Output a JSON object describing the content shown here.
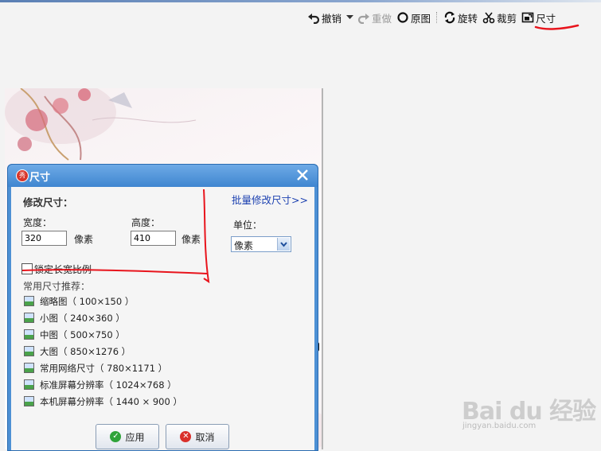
{
  "toolbar": {
    "undo": "撤销",
    "redo": "重做",
    "original": "原图",
    "rotate": "旋转",
    "crop": "裁剪",
    "resize": "尺寸"
  },
  "dialog": {
    "title": "尺寸",
    "section_title": "修改尺寸：",
    "batch_link": "批量修改尺寸>>",
    "width_label": "宽度：",
    "width_value": "320",
    "width_unit": "像素",
    "height_label": "高度：",
    "height_value": "410",
    "height_unit": "像素",
    "unit_label": "单位：",
    "unit_value": "像素",
    "lock_ratio_label": "锁定长宽比例",
    "presets_label": "常用尺寸推荐：",
    "presets": [
      "缩略图（ 100×150 ）",
      "小图（ 240×360 ）",
      "中图（ 500×750 ）",
      "大图（ 850×1276 ）",
      "常用网络尺寸（ 780×1171 ）",
      "标准屏幕分辨率（ 1024×768 ）",
      "本机屏幕分辨率（ 1440 × 900 ）"
    ],
    "apply_label": "应用",
    "cancel_label": "取消"
  },
  "watermark": {
    "text": "Bai du 经验",
    "sub": "jingyan.baidu.com"
  },
  "colors": {
    "dialog_blue": "#4d90d4",
    "annotation_red": "#e8141c",
    "link_blue": "#1a3fb0"
  }
}
